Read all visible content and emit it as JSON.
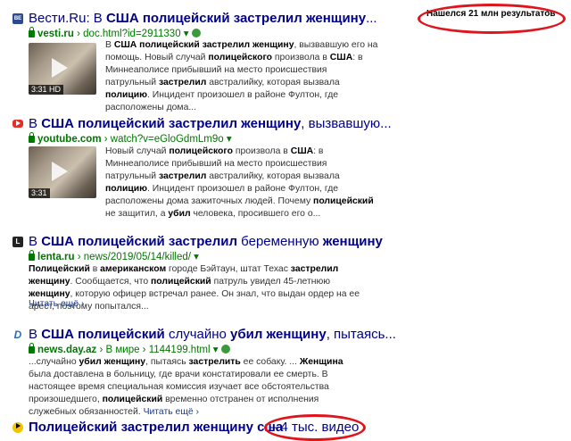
{
  "results": [
    {
      "title_parts": [
        {
          "t": "Вести.Ru: В ",
          "b": false
        },
        {
          "t": "США полицейский застрелил женщину",
          "b": true
        },
        {
          "t": "...",
          "b": false
        }
      ],
      "favicon": "ВЕ",
      "host": "vesti.ru",
      "path": "› doc.html?id=2911330 ▾",
      "duration": "3:31 HD",
      "snippet_parts": [
        {
          "t": "В ",
          "b": false
        },
        {
          "t": "США полицейский застрелил женщину",
          "b": true
        },
        {
          "t": ", вызвавшую его на помощь. Новый случай ",
          "b": false
        },
        {
          "t": "полицейского",
          "b": true
        },
        {
          "t": " произвола в ",
          "b": false
        },
        {
          "t": "США",
          "b": true
        },
        {
          "t": ": в Миннеаполисе прибывший на место происшествия патрульный ",
          "b": false
        },
        {
          "t": "застрелил",
          "b": true
        },
        {
          "t": " австралийку, которая вызвала ",
          "b": false
        },
        {
          "t": "полицию",
          "b": true
        },
        {
          "t": ". Инцидент произошел в районе Фултон, где расположены дома...",
          "b": false
        }
      ]
    },
    {
      "title_parts": [
        {
          "t": "В ",
          "b": false
        },
        {
          "t": "США полицейский застрелил женщину",
          "b": true
        },
        {
          "t": ", вызвавшую...",
          "b": false
        }
      ],
      "host": "youtube.com",
      "path": "› watch?v=eGloGdmLm9o ▾",
      "duration": "3:31",
      "snippet_parts": [
        {
          "t": "Новый случай ",
          "b": false
        },
        {
          "t": "полицейского",
          "b": true
        },
        {
          "t": " произвола в ",
          "b": false
        },
        {
          "t": "США",
          "b": true
        },
        {
          "t": ": в Миннеаполисе прибывший на место происшествия патрульный ",
          "b": false
        },
        {
          "t": "застрелил",
          "b": true
        },
        {
          "t": " австралийку, которая вызвала ",
          "b": false
        },
        {
          "t": "полицию",
          "b": true
        },
        {
          "t": ". Инцидент произошел в районе Фултон, где расположены дома зажиточных людей. Почему ",
          "b": false
        },
        {
          "t": "полицейский",
          "b": true
        },
        {
          "t": " не защитил, а ",
          "b": false
        },
        {
          "t": "убил",
          "b": true
        },
        {
          "t": " человека, просившего его о...",
          "b": false
        }
      ]
    },
    {
      "title_parts": [
        {
          "t": "В ",
          "b": false
        },
        {
          "t": "США полицейский застрелил",
          "b": true
        },
        {
          "t": " беременную ",
          "b": false
        },
        {
          "t": "женщину",
          "b": true
        }
      ],
      "favicon": "L",
      "host": "lenta.ru",
      "path": "› news/2019/05/14/killed/ ▾",
      "snippet_parts": [
        {
          "t": "Полицейский",
          "b": true
        },
        {
          "t": " в ",
          "b": false
        },
        {
          "t": "американском",
          "b": true
        },
        {
          "t": " городе Бэйтаун, штат Техас ",
          "b": false
        },
        {
          "t": "застрелил женщину",
          "b": true
        },
        {
          "t": ". Сообщается, что ",
          "b": false
        },
        {
          "t": "полицейский",
          "b": true
        },
        {
          "t": " патруль увидел 45-летнюю ",
          "b": false
        },
        {
          "t": "женщину",
          "b": true
        },
        {
          "t": ", которую офицер встречал ранее. Он знал, что выдан ордер на ее арест, поэтому попытался...",
          "b": false
        }
      ],
      "more": "Читать ещё ›"
    },
    {
      "title_parts": [
        {
          "t": "В ",
          "b": false
        },
        {
          "t": "США полицейский",
          "b": true
        },
        {
          "t": " случайно ",
          "b": false
        },
        {
          "t": "убил женщину",
          "b": true
        },
        {
          "t": ", пытаясь...",
          "b": false
        }
      ],
      "favicon": "D",
      "host": "news.day.az",
      "path": "› В мире › 1144199.html ▾",
      "snippet_parts": [
        {
          "t": "...случайно ",
          "b": false
        },
        {
          "t": "убил женщину",
          "b": true
        },
        {
          "t": ", пытаясь ",
          "b": false
        },
        {
          "t": "застрелить",
          "b": true
        },
        {
          "t": " ее собаку. ... ",
          "b": false
        },
        {
          "t": "Женщина",
          "b": true
        },
        {
          "t": " была доставлена в больницу, где врачи констатировали ее смерть. В настоящее время специальная комиссия изучает все обстоятельства произошедшего, ",
          "b": false
        },
        {
          "t": "полицейский",
          "b": true
        },
        {
          "t": " временно отстранен от исполнения служебных обязанностей.",
          "b": false
        }
      ],
      "more": "Читать ещё ›"
    },
    {
      "title_parts": [
        {
          "t": "Полицейский застрелил женщину сша",
          "b": true
        }
      ],
      "video_count": "– 4 тыс. видео"
    }
  ],
  "found_count": {
    "pre": "Нашелся ",
    "num": "21 млн",
    "post": " результатов"
  },
  "colors": {
    "title": "#00008b",
    "url": "#007700",
    "highlight": "#e0141d",
    "youtube": "#e52d27"
  }
}
